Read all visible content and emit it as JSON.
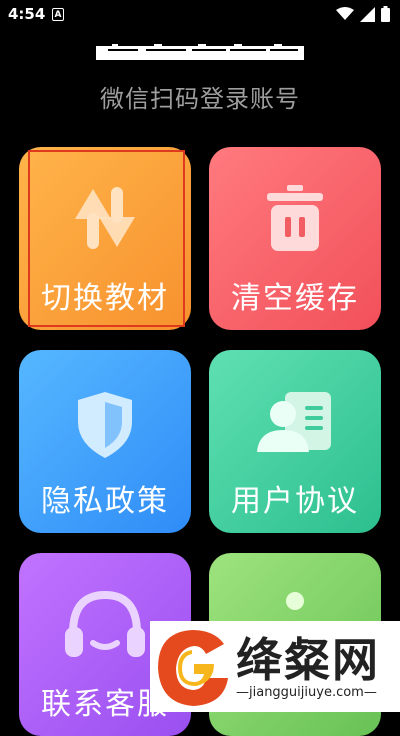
{
  "status_bar": {
    "time": "4:54",
    "badge": "A",
    "icons": [
      "wifi-icon",
      "signal-icon",
      "battery-icon"
    ]
  },
  "header": {
    "subtitle": "微信扫码登录账号"
  },
  "tiles": [
    {
      "label": "切换教材",
      "icon": "swap-icon",
      "color": "#f7a03a"
    },
    {
      "label": "清空缓存",
      "icon": "trash-icon",
      "color": "#f55f66"
    },
    {
      "label": "隐私政策",
      "icon": "shield-icon",
      "color": "#3e9ff9"
    },
    {
      "label": "用户协议",
      "icon": "user-card-icon",
      "color": "#3fcb9c"
    },
    {
      "label": "联系客服",
      "icon": "headset-icon",
      "color": "#ab5ff5"
    },
    {
      "label": "",
      "icon": "info-icon",
      "color": "#7fd068"
    }
  ],
  "watermark": {
    "text": "绛粲网",
    "url": "—jiangguijiuye.com—"
  }
}
